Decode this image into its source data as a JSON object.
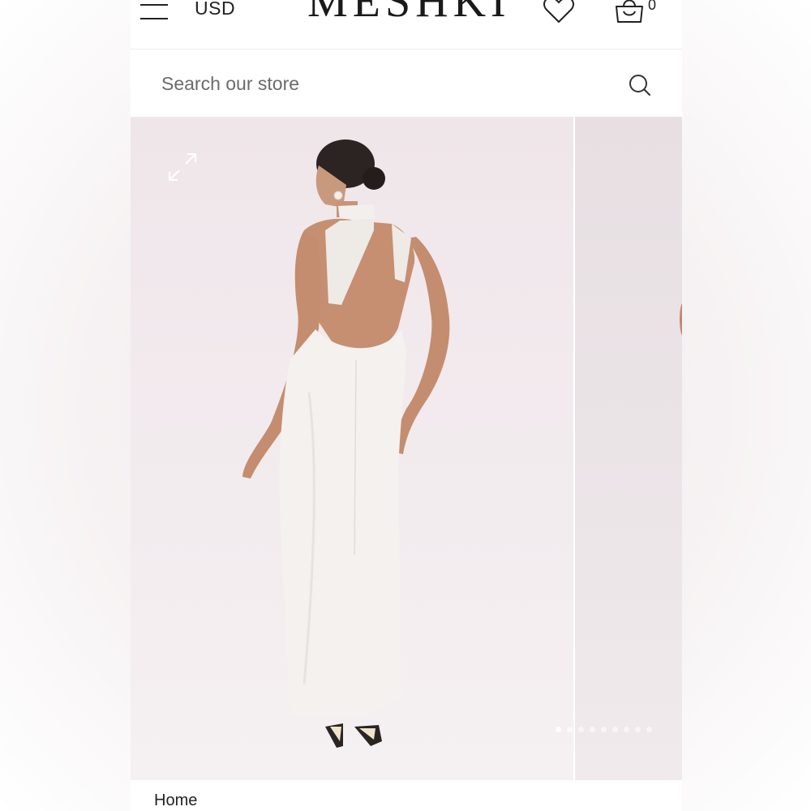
{
  "header": {
    "currency": "USD",
    "logo_text": "MESHKI",
    "cart_count": "0"
  },
  "search": {
    "placeholder": "Search our store"
  },
  "gallery": {
    "slide_count": 9,
    "active_index": 0,
    "background_color": "#efe6ea",
    "dress_color": "#f4f1ee"
  },
  "breadcrumb": {
    "home": "Home"
  }
}
